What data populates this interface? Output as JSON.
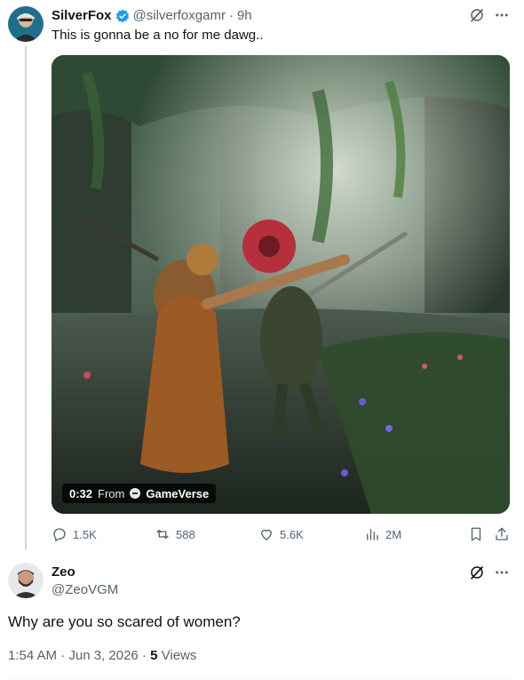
{
  "original_tweet": {
    "display_name": "SilverFox",
    "handle": "@silverfoxgamr",
    "time": "9h",
    "text": "This is gonna be a no for me dawg..",
    "video": {
      "duration": "0:32",
      "from_label": "From",
      "source": "GameVerse"
    },
    "stats": {
      "replies": "1.5K",
      "reposts": "588",
      "likes": "5.6K",
      "views": "2M"
    }
  },
  "reply": {
    "display_name": "Zeo",
    "handle": "@ZeoVGM",
    "text": "Why are you so scared of women?",
    "timestamp": "1:54 AM · Jun 3, 2026 ·",
    "views_count": "5",
    "views_label": "Views"
  },
  "colors": {
    "accent": "#1d9bf0",
    "muted": "#536471",
    "text": "#0f1419"
  }
}
